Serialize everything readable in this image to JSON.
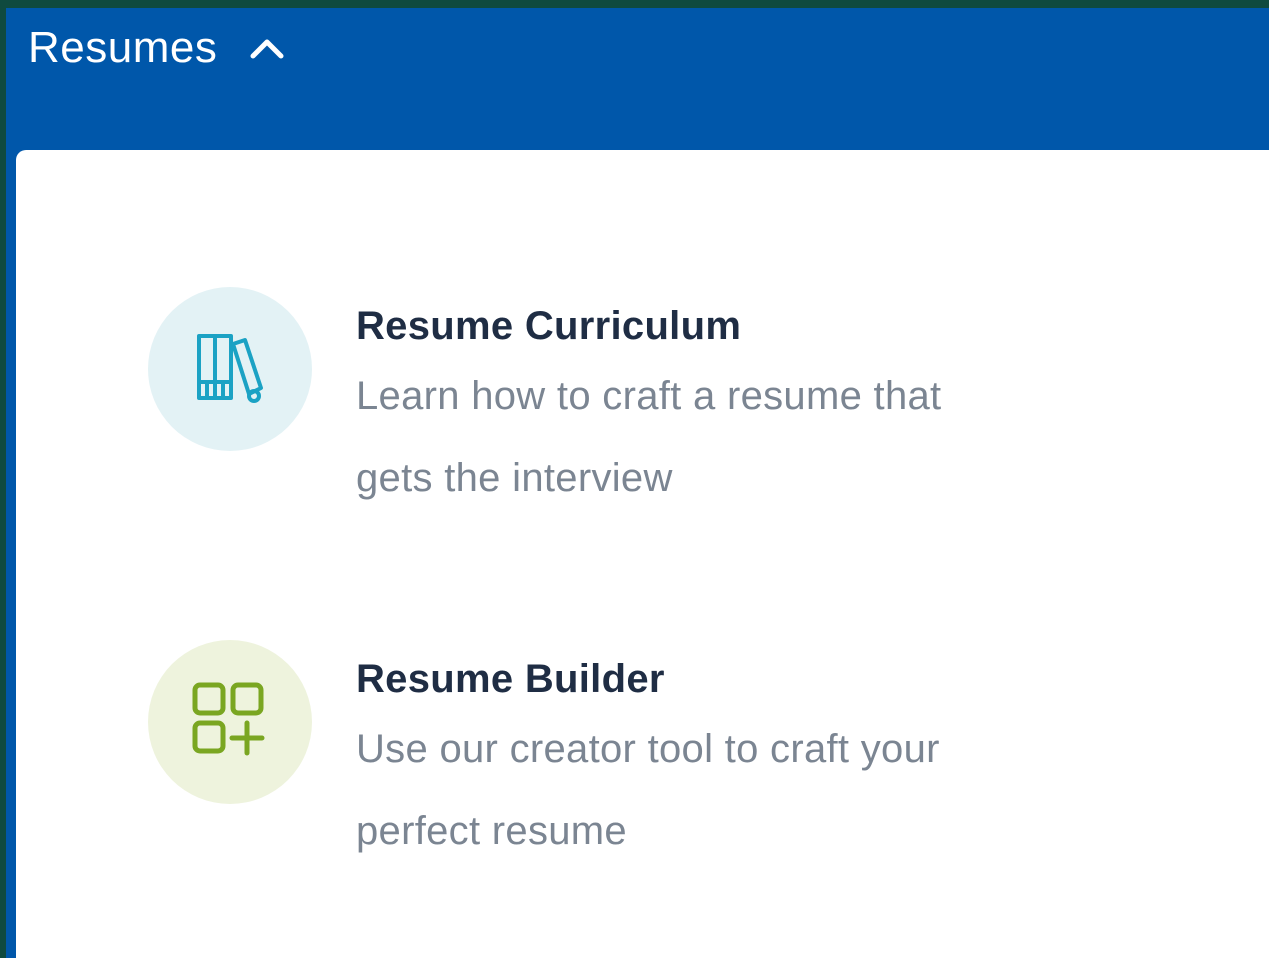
{
  "header": {
    "menu_title": "Resumes",
    "toggle_icon": "chevron-up-icon",
    "background_color": "#0057aa"
  },
  "panel": {
    "items": [
      {
        "title": "Resume Curriculum",
        "description_line1": "Learn how to craft a resume that",
        "description_line2": "gets the interview",
        "icon": "books-icon",
        "accent_color": "#1ba2c4"
      },
      {
        "title": "Resume Builder",
        "description_line1": "Use our creator tool to craft your",
        "description_line2": "perfect resume",
        "icon": "grid-plus-icon",
        "accent_color": "#7aa621"
      }
    ]
  }
}
